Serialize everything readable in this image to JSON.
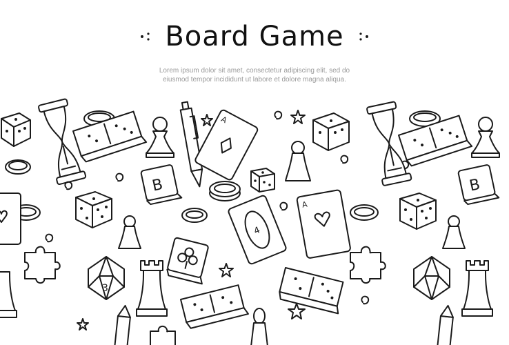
{
  "header": {
    "title": "Board Game",
    "subtitle_line1": "Lorem ipsum dolor sit amet, consectetur adipiscing elit, sed do",
    "subtitle_line2": "eiusmod tempor incididunt ut labore et dolore magna aliqua."
  },
  "doodles": {
    "letter_tile_a": "B",
    "letter_tile_b": "B",
    "card_letter": "A",
    "die_face": "3",
    "card_number": "4"
  }
}
